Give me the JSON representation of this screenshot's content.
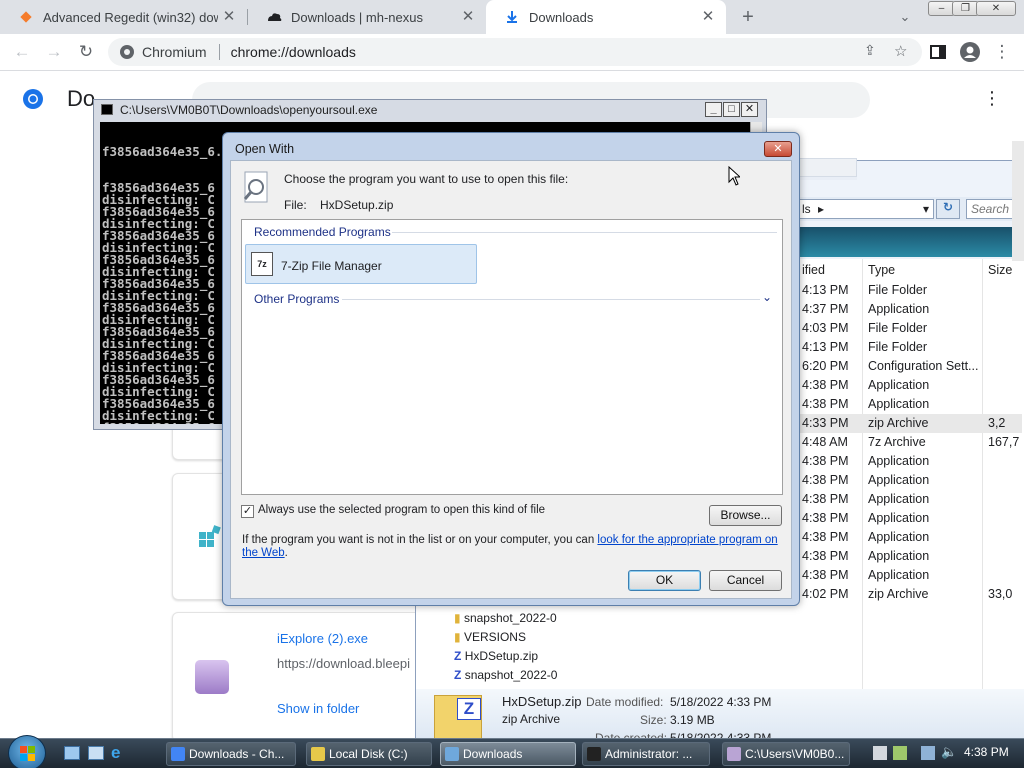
{
  "browser": {
    "tabs": [
      {
        "title": "Advanced Regedit (win32) downl",
        "icon": "diamond-icon"
      },
      {
        "title": "Downloads | mh-nexus",
        "icon": "cloud-icon"
      },
      {
        "title": "Downloads",
        "icon": "download-icon"
      }
    ],
    "new_tab": "+",
    "site_name": "Chromium",
    "url": "chrome://downloads",
    "window_buttons": [
      "–",
      "❐",
      "✕"
    ]
  },
  "downloads_page": {
    "title": "Downloads",
    "title_visible": "Do",
    "item2": {
      "filename": "iExplore (2).exe",
      "url": "https://download.bleepi",
      "show_in_folder": "Show in folder"
    }
  },
  "console": {
    "title": "C:\\Users\\VM0B0T\\Downloads\\openyoursoul.exe",
    "first_line": "f3856ad364e35_6.0.6001.18000_en-us_5a05a3f359dc66cd\\auditpol.exe.mui",
    "lines": [
      "f3856ad364e35_6",
      "disinfecting: C",
      "f3856ad364e35_6",
      "disinfecting: C",
      "f3856ad364e35_6",
      "disinfecting: C",
      "f3856ad364e35_6",
      "disinfecting: C",
      "f3856ad364e35_6",
      "disinfecting: C",
      "f3856ad364e35_6",
      "disinfecting: C",
      "f3856ad364e35_6",
      "disinfecting: C",
      "f3856ad364e35_6",
      "disinfecting: C",
      "f3856ad364e35_6",
      "disinfecting: C",
      "f3856ad364e35_6",
      "disinfecting: C",
      "f3856ad364e35_6",
      "disinfecting: C",
      "f3856ad364e35_6",
      "disinfecting: C"
    ]
  },
  "explorer": {
    "breadcrumb_tail": "ls",
    "search_placeholder": "Search",
    "columns": {
      "modified": "ified",
      "type": "Type",
      "size": "Size"
    },
    "rows": [
      {
        "time": "4:13 PM",
        "type": "File Folder",
        "size": ""
      },
      {
        "time": "4:37 PM",
        "type": "Application",
        "size": ""
      },
      {
        "time": "4:03 PM",
        "type": "File Folder",
        "size": ""
      },
      {
        "time": "4:13 PM",
        "type": "File Folder",
        "size": ""
      },
      {
        "time": "6:20 PM",
        "type": "Configuration Sett...",
        "size": ""
      },
      {
        "time": "4:38 PM",
        "type": "Application",
        "size": ""
      },
      {
        "time": "4:38 PM",
        "type": "Application",
        "size": ""
      },
      {
        "time": "4:33 PM",
        "type": "zip Archive",
        "size": "3,2"
      },
      {
        "time": "4:48 AM",
        "type": "7z Archive",
        "size": "167,7"
      },
      {
        "time": "4:38 PM",
        "type": "Application",
        "size": ""
      },
      {
        "time": "4:38 PM",
        "type": "Application",
        "size": ""
      },
      {
        "time": "4:38 PM",
        "type": "Application",
        "size": ""
      },
      {
        "time": "4:38 PM",
        "type": "Application",
        "size": ""
      },
      {
        "time": "4:38 PM",
        "type": "Application",
        "size": ""
      },
      {
        "time": "4:38 PM",
        "type": "Application",
        "size": ""
      },
      {
        "time": "4:38 PM",
        "type": "Application",
        "size": ""
      },
      {
        "time": "4:02 PM",
        "type": "zip Archive",
        "size": "33,0"
      }
    ],
    "tree": [
      "snapshot_2022-0",
      "VERSIONS",
      "HxDSetup.zip",
      "snapshot_2022-0"
    ],
    "details": {
      "name": "HxDSetup.zip",
      "kind": "zip Archive",
      "modified_label": "Date modified:",
      "modified_value": "5/18/2022 4:33 PM",
      "size_label": "Size:",
      "size_value": "3.19 MB",
      "created_label": "Date created:",
      "created_value": "5/18/2022 4:33 PM"
    },
    "tooltip": "Open With"
  },
  "dialog": {
    "title": "Open With",
    "prompt": "Choose the program you want to use to open this file:",
    "file_label": "File:",
    "file_name": "HxDSetup.zip",
    "recommended_header": "Recommended Programs",
    "recommended_programs": [
      "7-Zip File Manager"
    ],
    "other_header": "Other Programs",
    "always_use": "Always use the selected program to open this kind of file",
    "always_use_checked": true,
    "browse": "Browse...",
    "info_text": "If the program you want is not in the list or on your computer, you can ",
    "info_link": "look for the appropriate program on the Web",
    "info_end": ".",
    "ok": "OK",
    "cancel": "Cancel"
  },
  "taskbar": {
    "tasks": [
      {
        "label": "Downloads - Ch...",
        "color": "#4285f4"
      },
      {
        "label": "Local Disk (C:)",
        "color": "#e6c84a"
      },
      {
        "label": "Downloads",
        "color": "#6fa8dc"
      },
      {
        "label": "Administrator: ...",
        "color": "#222222"
      },
      {
        "label": "C:\\Users\\VM0B0...",
        "color": "#b9a4d4"
      }
    ],
    "clock": "4:38 PM"
  },
  "colors": {
    "chrome_tabstrip": "#dee1e6",
    "link": "#1a73e8",
    "dialog_frame": "#c3d3ea",
    "selection": "#dceaf8"
  }
}
